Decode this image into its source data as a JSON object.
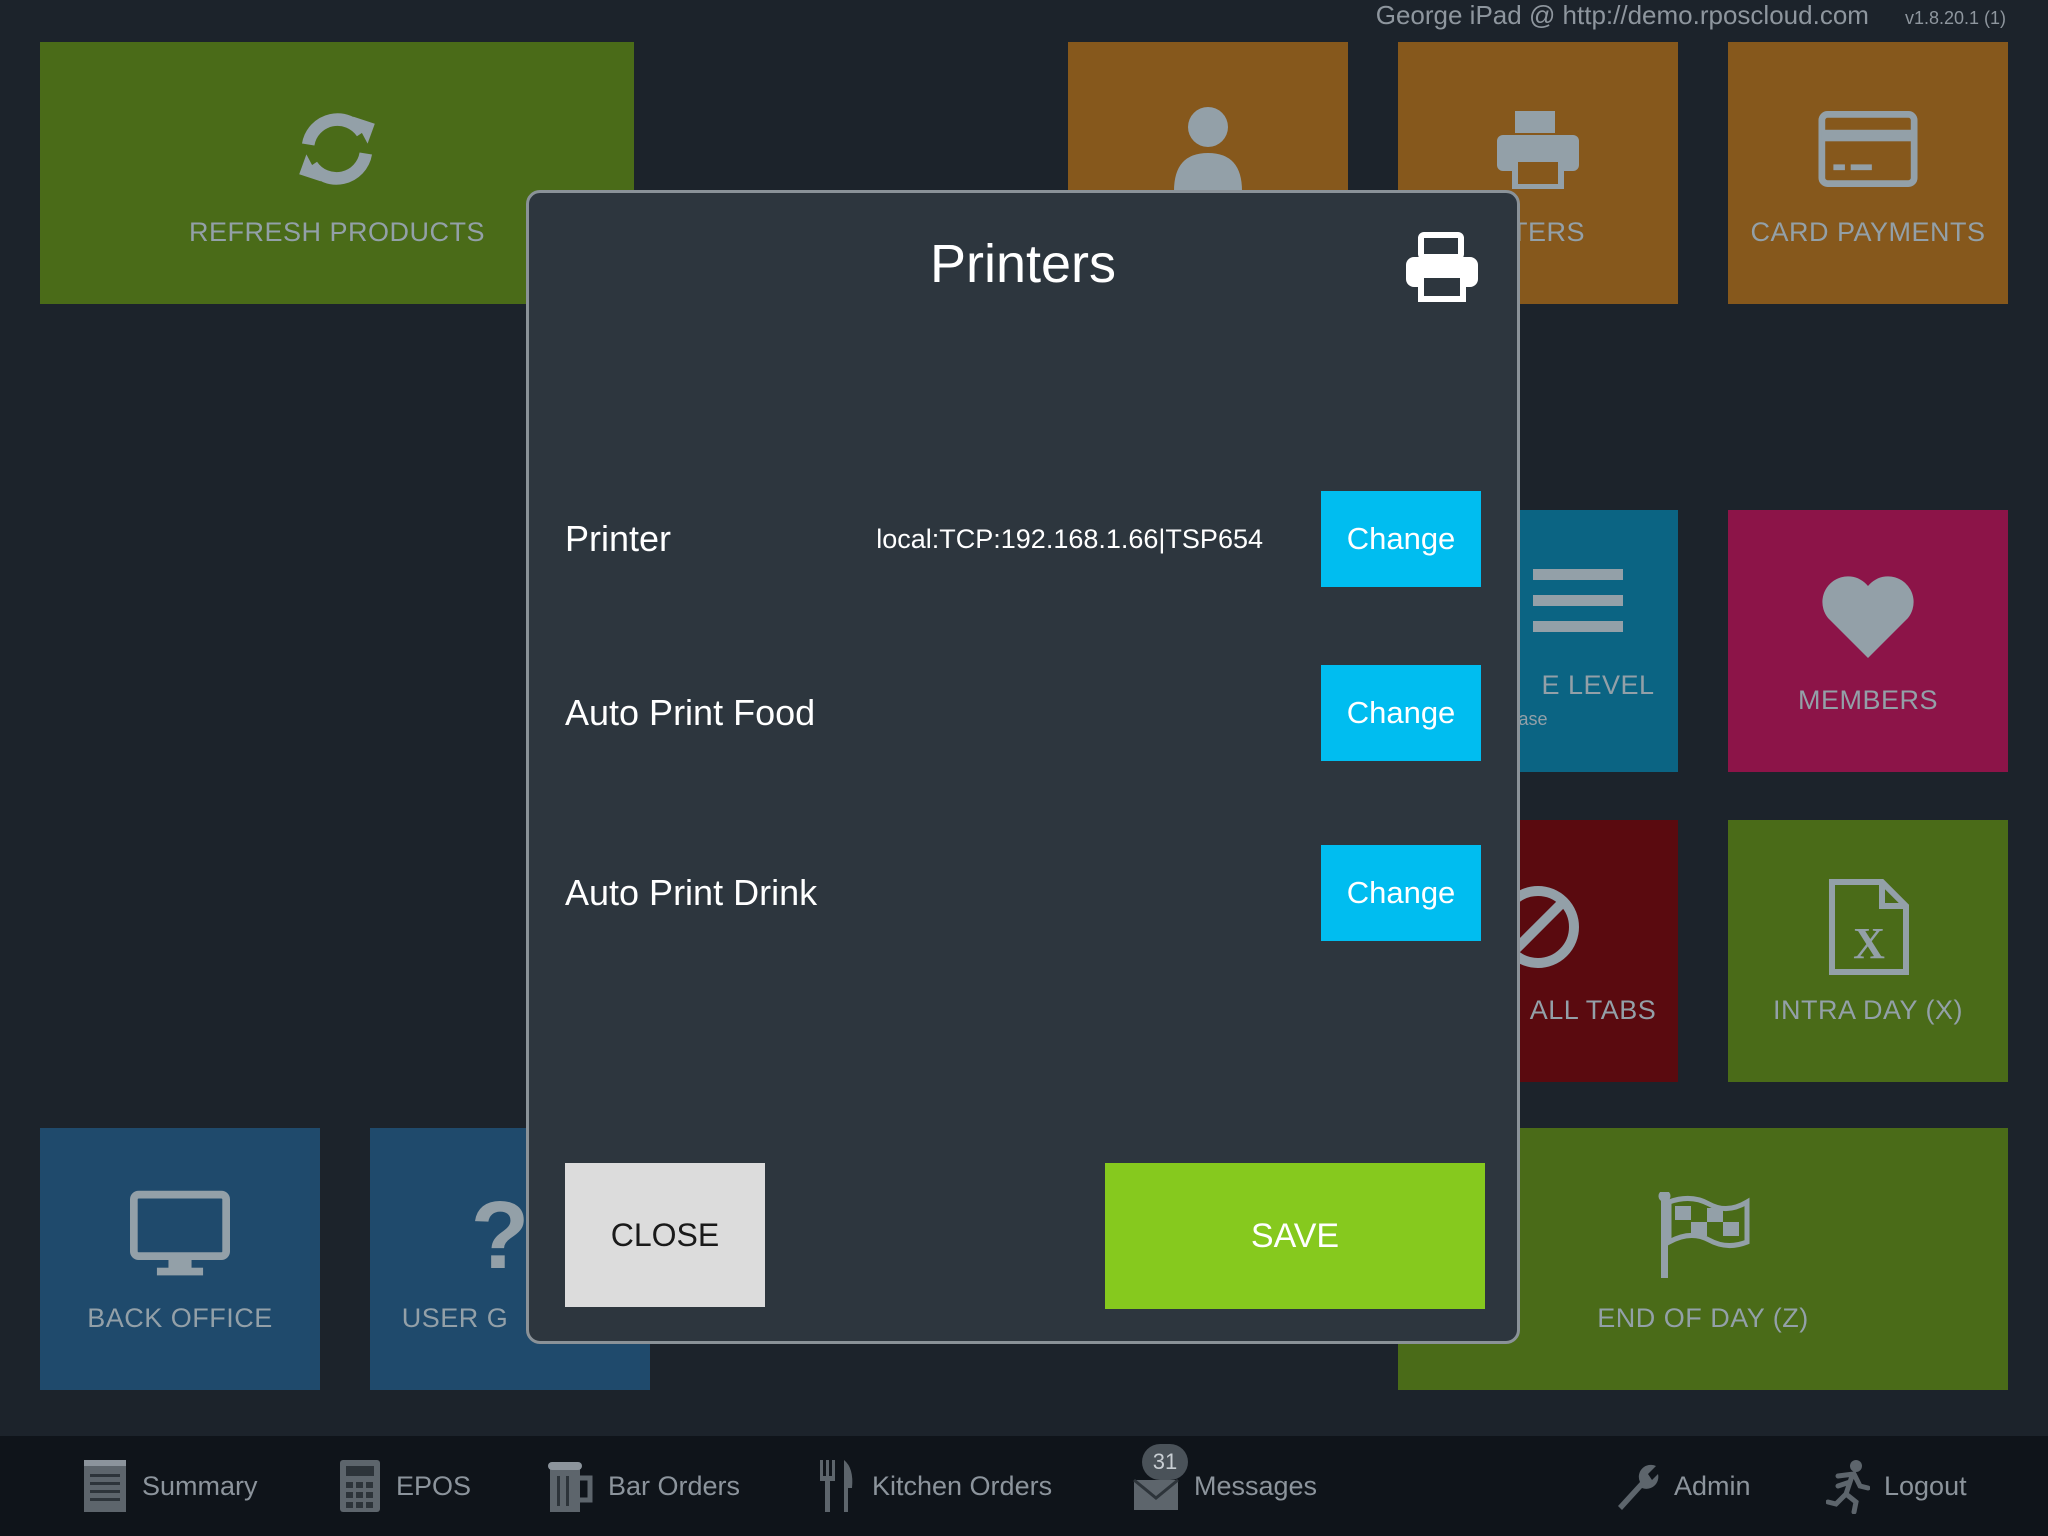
{
  "header": {
    "device": "George iPad @ http://demo.rposcloud.com",
    "version": "v1.8.20.1 (1)"
  },
  "tiles": {
    "refresh_products": "REFRESH PRODUCTS",
    "printers_partial": "NTERS",
    "card_payments": "CARD PAYMENTS",
    "price_level_partial": "E LEVEL",
    "price_level_sub_partial": "ase",
    "members": "MEMBERS",
    "all_tabs_partial": "ALL TABS",
    "intra_day": "INTRA DAY (X)",
    "back_office": "BACK OFFICE",
    "user_guide_partial": "USER G",
    "end_of_day": "END OF DAY (Z)"
  },
  "modal": {
    "title": "Printers",
    "rows": [
      {
        "label": "Printer",
        "value": "local:TCP:192.168.1.66|TSP654",
        "button": "Change"
      },
      {
        "label": "Auto Print Food",
        "value": "",
        "button": "Change"
      },
      {
        "label": "Auto Print Drink",
        "value": "",
        "button": "Change"
      }
    ],
    "close": "CLOSE",
    "save": "SAVE"
  },
  "tabbar": {
    "summary": "Summary",
    "epos": "EPOS",
    "bar_orders": "Bar Orders",
    "kitchen_orders": "Kitchen Orders",
    "messages": "Messages",
    "messages_count": "31",
    "admin": "Admin",
    "logout": "Logout"
  },
  "colors": {
    "accent_change": "#00bdf0",
    "save": "#86c91e",
    "background": "#1c232b"
  }
}
